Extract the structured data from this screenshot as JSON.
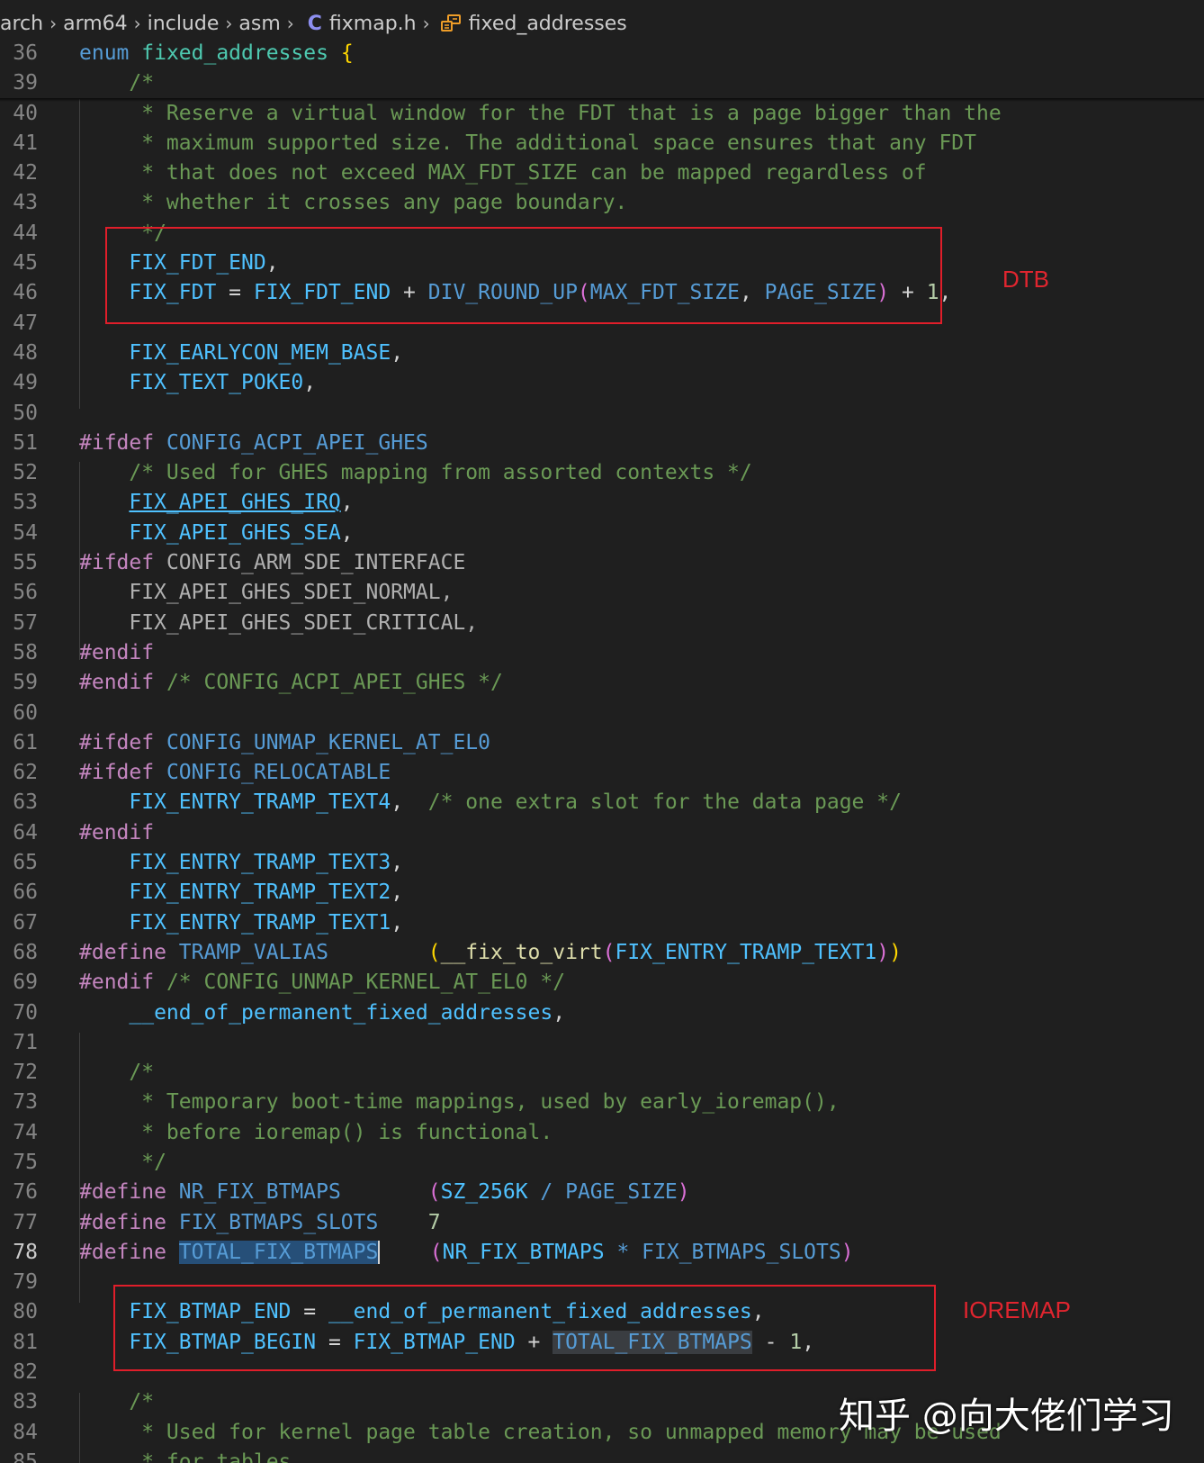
{
  "breadcrumb": {
    "items": [
      "arch",
      "arm64",
      "include",
      "asm"
    ],
    "file_icon": "C",
    "file": "fixmap.h",
    "symbol": "fixed_addresses"
  },
  "code": {
    "sticky": [
      {
        "n": "36",
        "t": [
          [
            "enum",
            "kw"
          ],
          [
            " "
          ],
          [
            "fixed_addresses",
            "ty"
          ],
          [
            " "
          ],
          [
            "{",
            "br1"
          ]
        ]
      },
      {
        "n": "39",
        "t": [
          [
            "    "
          ],
          [
            "/*",
            "cm"
          ]
        ]
      }
    ],
    "lines": [
      {
        "n": "40",
        "t": [
          [
            "     * Reserve a virtual window for the FDT that is a page bigger than the",
            "cm"
          ]
        ]
      },
      {
        "n": "41",
        "t": [
          [
            "     * maximum supported size. The additional space ensures that any FDT",
            "cm"
          ]
        ]
      },
      {
        "n": "42",
        "t": [
          [
            "     * that does not exceed MAX_FDT_SIZE can be mapped regardless of",
            "cm"
          ]
        ]
      },
      {
        "n": "43",
        "t": [
          [
            "     * whether it crosses any page boundary.",
            "cm"
          ]
        ]
      },
      {
        "n": "44",
        "t": [
          [
            "     */",
            "cm"
          ]
        ]
      },
      {
        "n": "45",
        "t": [
          [
            "    "
          ],
          [
            "FIX_FDT_END",
            "en"
          ],
          [
            ",",
            "op"
          ]
        ]
      },
      {
        "n": "46",
        "t": [
          [
            "    "
          ],
          [
            "FIX_FDT",
            "en"
          ],
          [
            " = ",
            "op"
          ],
          [
            "FIX_FDT_END",
            "en"
          ],
          [
            " + ",
            "op"
          ],
          [
            "DIV_ROUND_UP",
            "mac"
          ],
          [
            "(",
            "br2"
          ],
          [
            "MAX_FDT_SIZE",
            "mac"
          ],
          [
            ", ",
            "op"
          ],
          [
            "PAGE_SIZE",
            "mac"
          ],
          [
            ")",
            "br2"
          ],
          [
            " + ",
            "op"
          ],
          [
            "1",
            "num"
          ],
          [
            ",",
            "op"
          ]
        ]
      },
      {
        "n": "47",
        "t": [
          [
            ""
          ]
        ]
      },
      {
        "n": "48",
        "t": [
          [
            "    "
          ],
          [
            "FIX_EARLYCON_MEM_BASE",
            "en"
          ],
          [
            ",",
            "op"
          ]
        ]
      },
      {
        "n": "49",
        "t": [
          [
            "    "
          ],
          [
            "FIX_TEXT_POKE0",
            "en"
          ],
          [
            ",",
            "op"
          ]
        ]
      },
      {
        "n": "50",
        "t": [
          [
            ""
          ]
        ]
      },
      {
        "n": "51",
        "t": [
          [
            "#ifdef",
            "pp"
          ],
          [
            " "
          ],
          [
            "CONFIG_ACPI_APEI_GHES",
            "mac"
          ]
        ]
      },
      {
        "n": "52",
        "t": [
          [
            "    "
          ],
          [
            "/* Used for GHES mapping from assorted contexts */",
            "cm"
          ]
        ]
      },
      {
        "n": "53",
        "t": [
          [
            "    "
          ],
          [
            "FIX_APEI_GHES_IRQ",
            "en ul"
          ],
          [
            ",",
            "op"
          ]
        ]
      },
      {
        "n": "54",
        "t": [
          [
            "    "
          ],
          [
            "FIX_APEI_GHES_SEA",
            "en"
          ],
          [
            ",",
            "op"
          ]
        ]
      },
      {
        "n": "55",
        "t": [
          [
            "#ifdef",
            "pp"
          ],
          [
            " "
          ],
          [
            "CONFIG_ARM_SDE_INTERFACE",
            "ppn"
          ]
        ]
      },
      {
        "n": "56",
        "t": [
          [
            "    "
          ],
          [
            "FIX_APEI_GHES_SDEI_NORMAL,",
            "ppn"
          ]
        ]
      },
      {
        "n": "57",
        "t": [
          [
            "    "
          ],
          [
            "FIX_APEI_GHES_SDEI_CRITICAL,",
            "ppn"
          ]
        ]
      },
      {
        "n": "58",
        "t": [
          [
            "#endif",
            "pp"
          ]
        ]
      },
      {
        "n": "59",
        "t": [
          [
            "#endif",
            "pp"
          ],
          [
            " "
          ],
          [
            "/* CONFIG_ACPI_APEI_GHES */",
            "cm"
          ]
        ]
      },
      {
        "n": "60",
        "t": [
          [
            ""
          ]
        ]
      },
      {
        "n": "61",
        "t": [
          [
            "#ifdef",
            "pp"
          ],
          [
            " "
          ],
          [
            "CONFIG_UNMAP_KERNEL_AT_EL0",
            "mac"
          ]
        ]
      },
      {
        "n": "62",
        "t": [
          [
            "#ifdef",
            "pp"
          ],
          [
            " "
          ],
          [
            "CONFIG_RELOCATABLE",
            "mac"
          ]
        ]
      },
      {
        "n": "63",
        "t": [
          [
            "    "
          ],
          [
            "FIX_ENTRY_TRAMP_TEXT4",
            "en"
          ],
          [
            ",",
            "op"
          ],
          [
            "  "
          ],
          [
            "/* one extra slot for the data page */",
            "cm"
          ]
        ]
      },
      {
        "n": "64",
        "t": [
          [
            "#endif",
            "pp"
          ]
        ]
      },
      {
        "n": "65",
        "t": [
          [
            "    "
          ],
          [
            "FIX_ENTRY_TRAMP_TEXT3",
            "en"
          ],
          [
            ",",
            "op"
          ]
        ]
      },
      {
        "n": "66",
        "t": [
          [
            "    "
          ],
          [
            "FIX_ENTRY_TRAMP_TEXT2",
            "en"
          ],
          [
            ",",
            "op"
          ]
        ]
      },
      {
        "n": "67",
        "t": [
          [
            "    "
          ],
          [
            "FIX_ENTRY_TRAMP_TEXT1",
            "en"
          ],
          [
            ",",
            "op"
          ]
        ]
      },
      {
        "n": "68",
        "t": [
          [
            "#define",
            "pp"
          ],
          [
            " "
          ],
          [
            "TRAMP_VALIAS",
            "mac"
          ],
          [
            "        "
          ],
          [
            "(",
            "br1"
          ],
          [
            "__fix_to_virt",
            "fn"
          ],
          [
            "(",
            "br2"
          ],
          [
            "FIX_ENTRY_TRAMP_TEXT1",
            "en"
          ],
          [
            ")",
            "br2"
          ],
          [
            ")",
            "br1"
          ]
        ]
      },
      {
        "n": "69",
        "t": [
          [
            "#endif",
            "pp"
          ],
          [
            " "
          ],
          [
            "/* CONFIG_UNMAP_KERNEL_AT_EL0 */",
            "cm"
          ]
        ]
      },
      {
        "n": "70",
        "t": [
          [
            "    "
          ],
          [
            "__end_of_permanent_fixed_addresses",
            "en"
          ],
          [
            ",",
            "op"
          ]
        ]
      },
      {
        "n": "71",
        "t": [
          [
            ""
          ]
        ]
      },
      {
        "n": "72",
        "t": [
          [
            "    "
          ],
          [
            "/*",
            "cm"
          ]
        ]
      },
      {
        "n": "73",
        "t": [
          [
            "     * Temporary boot-time mappings, used by early_ioremap(),",
            "cm"
          ]
        ]
      },
      {
        "n": "74",
        "t": [
          [
            "     * before ioremap() is functional.",
            "cm"
          ]
        ]
      },
      {
        "n": "75",
        "t": [
          [
            "     */",
            "cm"
          ]
        ]
      },
      {
        "n": "76",
        "t": [
          [
            "#define",
            "pp"
          ],
          [
            " "
          ],
          [
            "NR_FIX_BTMAPS",
            "mac"
          ],
          [
            "       "
          ],
          [
            "(",
            "br2"
          ],
          [
            "SZ_256K",
            "en"
          ],
          [
            " / ",
            "mac"
          ],
          [
            "PAGE_SIZE",
            "mac"
          ],
          [
            ")",
            "br2"
          ]
        ]
      },
      {
        "n": "77",
        "t": [
          [
            "#define",
            "pp"
          ],
          [
            " "
          ],
          [
            "FIX_BTMAPS_SLOTS",
            "mac"
          ],
          [
            "    "
          ],
          [
            "7",
            "num"
          ]
        ]
      },
      {
        "n": "78",
        "active": true,
        "t": [
          [
            "#define",
            "pp"
          ],
          [
            " "
          ],
          [
            "TOTAL_FIX_BTMAPS",
            "mac hl cursor"
          ],
          [
            "    "
          ],
          [
            "(",
            "br2"
          ],
          [
            "NR_FIX_BTMAPS",
            "en"
          ],
          [
            " * ",
            "mac"
          ],
          [
            "FIX_BTMAPS_SLOTS",
            "mac"
          ],
          [
            ")",
            "br2"
          ]
        ]
      },
      {
        "n": "79",
        "t": [
          [
            ""
          ]
        ]
      },
      {
        "n": "80",
        "t": [
          [
            "    "
          ],
          [
            "FIX_BTMAP_END",
            "en"
          ],
          [
            " = ",
            "op"
          ],
          [
            "__end_of_permanent_fixed_addresses",
            "en"
          ],
          [
            ",",
            "op"
          ]
        ]
      },
      {
        "n": "81",
        "t": [
          [
            "    "
          ],
          [
            "FIX_BTMAP_BEGIN",
            "en"
          ],
          [
            " = ",
            "op"
          ],
          [
            "FIX_BTMAP_END",
            "en"
          ],
          [
            " + ",
            "op"
          ],
          [
            "TOTAL_FIX_BTMAPS",
            "mac hl2"
          ],
          [
            " - ",
            "op"
          ],
          [
            "1",
            "num"
          ],
          [
            ",",
            "op"
          ]
        ]
      },
      {
        "n": "82",
        "t": [
          [
            ""
          ]
        ]
      },
      {
        "n": "83",
        "t": [
          [
            "    "
          ],
          [
            "/*",
            "cm"
          ]
        ]
      },
      {
        "n": "84",
        "t": [
          [
            "     * Used for kernel page table creation, so unmapped memory may be used",
            "cm"
          ]
        ]
      },
      {
        "n": "85",
        "t": [
          [
            "     * for tables.",
            "cm"
          ]
        ]
      }
    ]
  },
  "annotations": {
    "dtb": "DTB",
    "ioremap": "IOREMAP"
  },
  "watermark": "知乎 @向大佬们学习",
  "colors": {
    "background": "#1f1f1f",
    "annotation_red": "#e01e2a",
    "keyword": "#569cd6",
    "enum_member": "#4fc1ff",
    "comment": "#6a9955",
    "preprocessor": "#c586c0"
  }
}
